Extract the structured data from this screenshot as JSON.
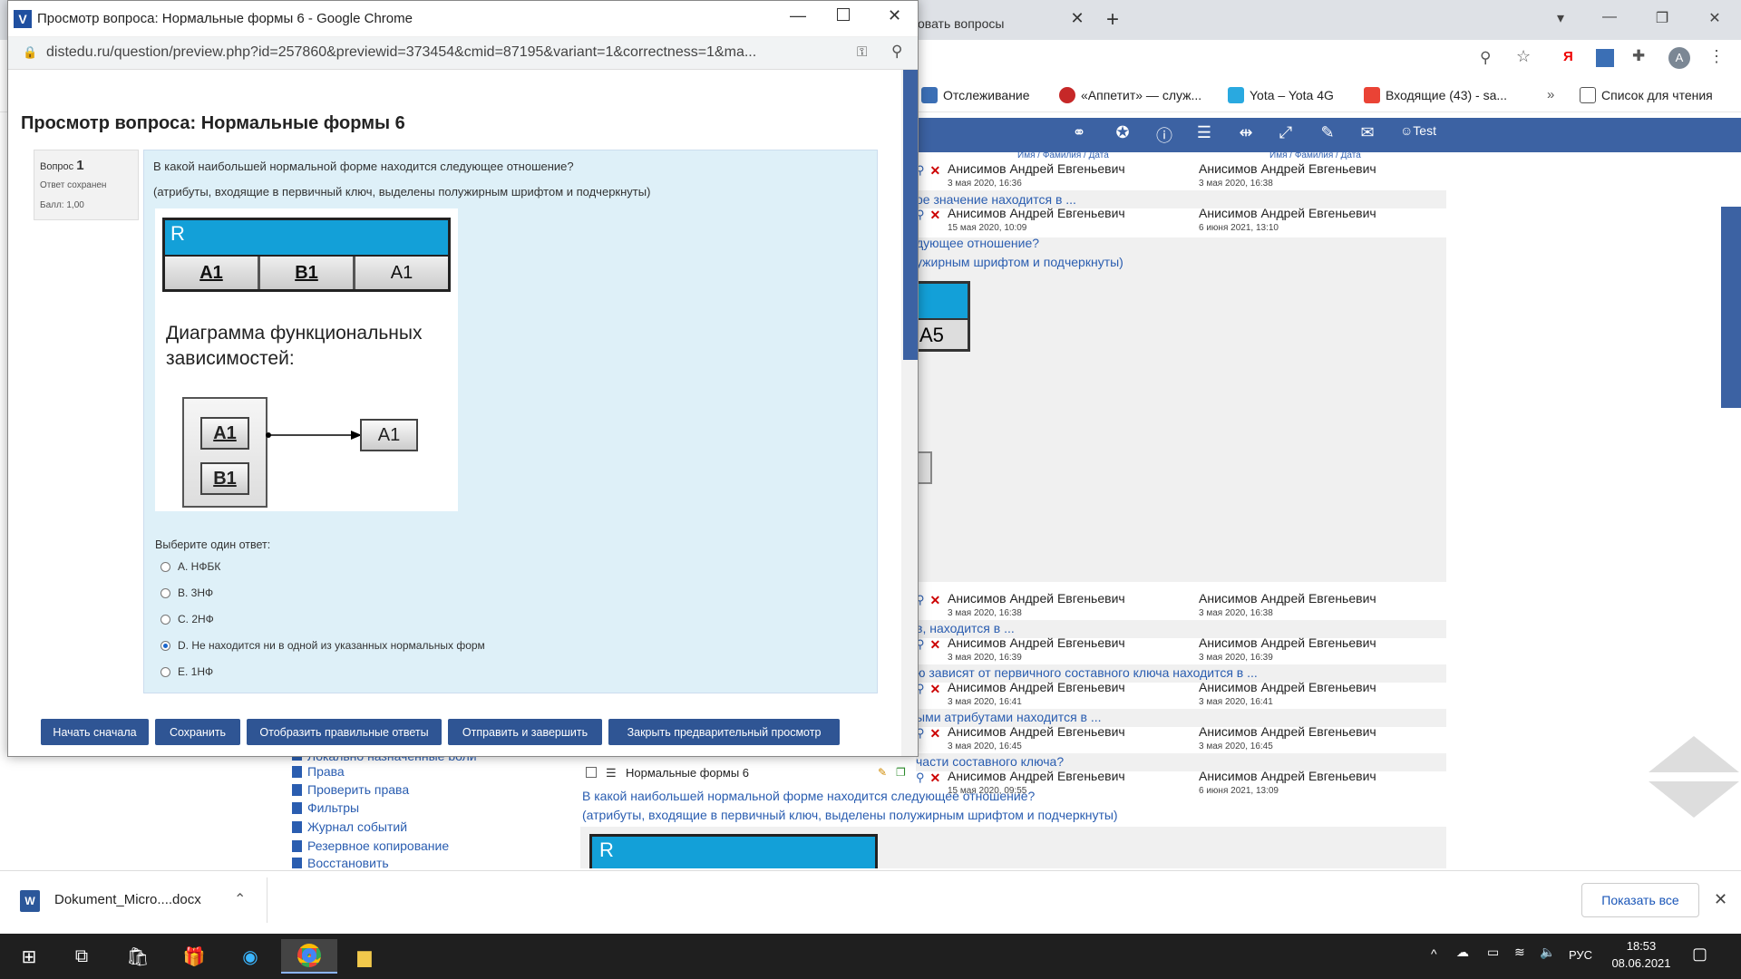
{
  "popup": {
    "window_title": "Просмотр вопроса: Нормальные формы 6 - Google Chrome",
    "url": "distedu.ru/question/preview.php?id=257860&previewid=373454&cmid=87195&variant=1&correctness=1&ma...",
    "page_heading": "Просмотр вопроса: Нормальные формы 6",
    "question_info": {
      "label": "Вопрос",
      "number": "1",
      "status": "Ответ сохранен",
      "score": "Балл: 1,00"
    },
    "question_text": "В какой наибольшей нормальной форме находится следующее отношение?",
    "question_note": "(атрибуты, входящие в первичный ключ, выделены полужирным шрифтом и подчеркнуты)",
    "relation": {
      "name": "R",
      "attributes": [
        "A1",
        "B1",
        "A1"
      ]
    },
    "diagram_title_line1": "Диаграмма функциональных",
    "diagram_title_line2": "зависимостей:",
    "diagram": {
      "key_attrs": [
        "A1",
        "B1"
      ],
      "dependent": "A1"
    },
    "prompt": "Выберите один ответ:",
    "options": [
      {
        "text": "A. НФБК",
        "selected": false
      },
      {
        "text": "B. 3НФ",
        "selected": false
      },
      {
        "text": "C. 2НФ",
        "selected": false
      },
      {
        "text": "D. Не находится ни в одной из указанных нормальных форм",
        "selected": true
      },
      {
        "text": "E. 1НФ",
        "selected": false
      }
    ],
    "buttons": {
      "restart": "Начать сначала",
      "save": "Сохранить",
      "show_correct": "Отобразить правильные ответы",
      "submit": "Отправить и завершить",
      "close": "Закрыть предварительный просмотр"
    }
  },
  "background": {
    "tab_title": "овать вопросы",
    "bookmarks": [
      "Отслеживание",
      "«Аппетит» — служ...",
      "Yota – Yota 4G",
      "Входящие (43) - sa...",
      "Список для чтения"
    ],
    "navbar_user": "Test",
    "column_header": "Имя / Фамилия / Дата",
    "rows": [
      {
        "creator": "Анисимов Андрей Евгеньевич",
        "created": "3 мая 2020, 16:36",
        "modifier": "Анисимов Андрей Евгеньевич",
        "modified": "3 мая 2020, 16:38",
        "text": "ое значение находится в ..."
      },
      {
        "creator": "Анисимов Андрей Евгеньевич",
        "created": "15 мая 2020, 10:09",
        "modifier": "Анисимов Андрей Евгеньевич",
        "modified": "6 июня 2021, 13:10",
        "text": "дующее отношение?"
      },
      {
        "creator": "Анисимов Андрей Евгеньевич",
        "created": "3 мая 2020, 16:38",
        "modifier": "Анисимов Андрей Евгеньевич",
        "modified": "3 мая 2020, 16:38",
        "text": "в, находится в ..."
      },
      {
        "creator": "Анисимов Андрей Евгеньевич",
        "created": "3 мая 2020, 16:39",
        "modifier": "Анисимов Андрей Евгеньевич",
        "modified": "3 мая 2020, 16:39",
        "text": "ю зависят от первичного составного ключа находится в ..."
      },
      {
        "creator": "Анисимов Андрей Евгеньевич",
        "created": "3 мая 2020, 16:41",
        "modifier": "Анисимов Андрей Евгеньевич",
        "modified": "3 мая 2020, 16:41",
        "text": "ыми атрибутами находится в ..."
      },
      {
        "creator": "Анисимов Андрей Евгеньевич",
        "created": "3 мая 2020, 16:45",
        "modifier": "Анисимов Андрей Евгеньевич",
        "modified": "3 мая 2020, 16:45",
        "text": "части составного ключа?"
      },
      {
        "creator": "Анисимов Андрей Евгеньевич",
        "created": "15 мая 2020, 09:55",
        "modifier": "Анисимов Андрей Евгеньевич",
        "modified": "6 июня 2021, 13:09",
        "text": ""
      }
    ],
    "row2_note": "ужирным шрифтом и подчеркнуты)",
    "last_row_name": "Нормальные формы 6",
    "last_question": "В какой наибольшей нормальной форме находится следующее отношение?",
    "last_note": "(атрибуты, входящие в первичный ключ, выделены полужирным шрифтом и подчеркнуты)",
    "preview_cell": "A5",
    "preview_r": "R",
    "sidebar": [
      "Права",
      "Проверить права",
      "Фильтры",
      "Журнал событий",
      "Резервное копирование",
      "Восстановить"
    ],
    "sidebar_partial": "Локально назначенные роли"
  },
  "downloads": {
    "file": "Dokument_Micro....docx",
    "show_all": "Показать все"
  },
  "taskbar": {
    "lang": "РУС",
    "time": "18:53",
    "date": "08.06.2021"
  },
  "colors": {
    "accent": "#3c62a3",
    "button": "#2f5594",
    "question_bg": "#def0f8",
    "relation_header": "#13a0d8"
  }
}
